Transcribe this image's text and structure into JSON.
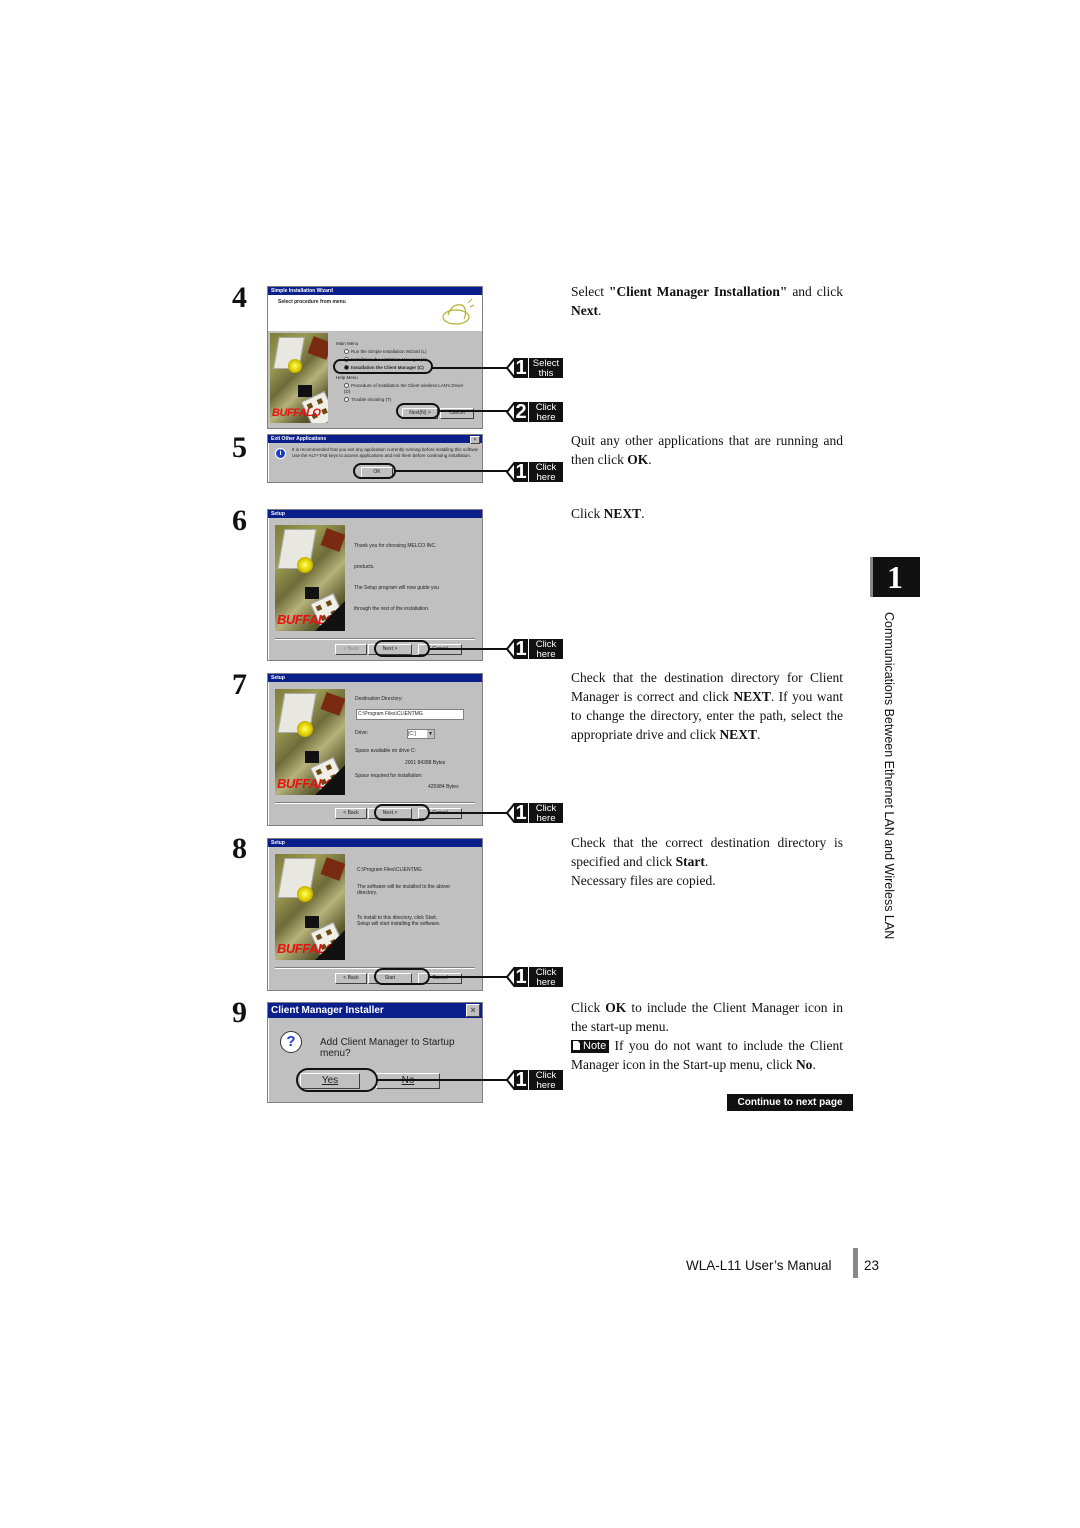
{
  "page": {
    "footer_title": "WLA-L11 User’s Manual",
    "page_number": "23",
    "chapter_number": "1",
    "chapter_title": "Communications Between Ethernet LAN and Wireless LAN",
    "continue_label": "Continue to next page"
  },
  "steps": [
    {
      "number": "4",
      "screenshot": {
        "title": "Simple Installation Wizard",
        "heading": "Select procedure from menu",
        "main_menu_label": "Main Menu",
        "options": [
          "Run the Simple Installation Wizard (L)",
          "Installation the AirStation Manager (A)",
          "Installation the Client Manager (C)"
        ],
        "help_menu_label": "Help Menu",
        "help_options": [
          "Procedure of installation the Client wireless LAN's Driver (D)",
          "Trouble shooting (T)"
        ],
        "next_button": "Next(N) >",
        "cancel_button": "Cancel"
      },
      "callouts": [
        {
          "num": "1",
          "line1": "Select",
          "line2": "this"
        },
        {
          "num": "2",
          "line1": "Click",
          "line2": "here"
        }
      ],
      "text_parts": [
        "Select ",
        "\"Client Manager Installation\"",
        " and click ",
        "Next",
        "."
      ]
    },
    {
      "number": "5",
      "screenshot": {
        "title": "Exit Other Applications",
        "message_line1": "It is recommended that you exit any application currently running before installing this software.",
        "message_line2": "Use the ALT+TAB keys to access applications and exit them before continuing installation.",
        "ok_button": "OK"
      },
      "callouts": [
        {
          "num": "1",
          "line1": "Click",
          "line2": "here"
        }
      ],
      "text_parts": [
        "Quit any other applications that are running and then click ",
        "OK",
        "."
      ]
    },
    {
      "number": "6",
      "screenshot": {
        "title": "Setup",
        "lines": [
          "Thank you for choosing MELCO INC.",
          "products.",
          "The Setup program will now guide you",
          "through the rest of the installation."
        ],
        "back_button": "< Back",
        "next_button": "Next >",
        "cancel_button": "Cancel",
        "logo": "BUFFALO"
      },
      "callouts": [
        {
          "num": "1",
          "line1": "Click",
          "line2": "here"
        }
      ],
      "text_parts": [
        "Click ",
        "NEXT",
        "."
      ]
    },
    {
      "number": "7",
      "screenshot": {
        "title": "Setup",
        "dest_label": "Destination Directory:",
        "dest_value": "C:\\Program Files\\CLIENTMG",
        "drive_label": "Drive:",
        "drive_value": "[C:]",
        "space_avail_label": "Space available on drive C:",
        "space_avail_value": "2001 84288 Bytes",
        "space_req_label": "Space required for installation:",
        "space_req_value": "425984 Bytes",
        "back_button": "< Back",
        "next_button": "Next >",
        "cancel_button": "Cancel",
        "logo": "BUFFALO"
      },
      "callouts": [
        {
          "num": "1",
          "line1": "Click",
          "line2": "here"
        }
      ],
      "text_parts": [
        "Check that the destination directory for Client Manager is correct and click ",
        "NEXT",
        ". If you want to change the directory, enter the path, select the appropriate drive and click ",
        "NEXT",
        "."
      ]
    },
    {
      "number": "8",
      "screenshot": {
        "title": "Setup",
        "path": "C:\\Program Files\\CLIENTMG",
        "line1": "The software will be installed to the above directory.",
        "line2": "To install to this directory, click Start.",
        "line3": "Setup will start installing the software.",
        "back_button": "< Back",
        "start_button": "Start",
        "cancel_button": "Cancel",
        "logo": "BUFFALO"
      },
      "callouts": [
        {
          "num": "1",
          "line1": "Click",
          "line2": "here"
        }
      ],
      "text_parts": [
        "Check that the correct destination directory is specified and click ",
        "Start",
        ".",
        "Necessary files are copied."
      ]
    },
    {
      "number": "9",
      "screenshot": {
        "title": "Client Manager Installer",
        "question": "Add Client Manager to Startup menu?",
        "yes_button": "Yes",
        "no_button": "No"
      },
      "callouts": [
        {
          "num": "1",
          "line1": "Click",
          "line2": "here"
        }
      ],
      "text_parts": [
        "Click ",
        "OK",
        " to include the Client Manager icon in the start-up menu."
      ],
      "note_label": "Note",
      "note_parts": [
        " If you do not want to include the Client Manager icon in the Start-up menu, click ",
        "No",
        "."
      ]
    }
  ]
}
